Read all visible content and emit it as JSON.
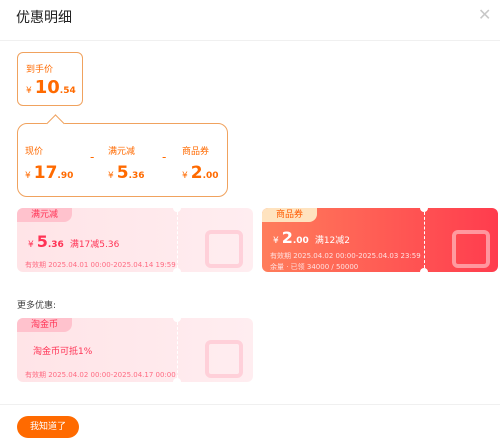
{
  "dialog": {
    "title": "优惠明细",
    "close_icon": "close-icon"
  },
  "final_price": {
    "label": "到手价",
    "currency": "¥",
    "integer": "10",
    "decimal": ".54"
  },
  "calc": {
    "items": [
      {
        "label": "现价",
        "currency": "¥",
        "integer": "17",
        "decimal": ".90"
      },
      {
        "label": "满元减",
        "currency": "¥",
        "integer": "5",
        "decimal": ".36"
      },
      {
        "label": "商品券",
        "currency": "¥",
        "integer": "2",
        "decimal": ".00"
      }
    ],
    "operator": "-"
  },
  "coupons": [
    {
      "tag": "满元减",
      "currency": "¥",
      "integer": "5",
      "decimal": ".36",
      "condition": "满17减5.36",
      "validity": "有效期 2025.04.01 00:00-2025.04.14 19:59"
    },
    {
      "tag": "商品券",
      "currency": "¥",
      "integer": "2",
      "decimal": ".00",
      "condition": "满12减2",
      "validity": "有效期 2025.04.02 00:00-2025.04.03 23:59",
      "stock": "余量 · 已领 34000 / 50000"
    }
  ],
  "more": {
    "label": "更多优惠:",
    "coupon": {
      "tag": "淘金币",
      "text": "淘金币可抵1%",
      "validity": "有效期 2025.04.02 00:00-2025.04.17 00:00"
    }
  },
  "footer": {
    "confirm": "我知道了"
  },
  "colors": {
    "accent": "#ff6a00",
    "coupon_red": "#ff3c4e",
    "coupon_pink": "#ffe4e7"
  }
}
